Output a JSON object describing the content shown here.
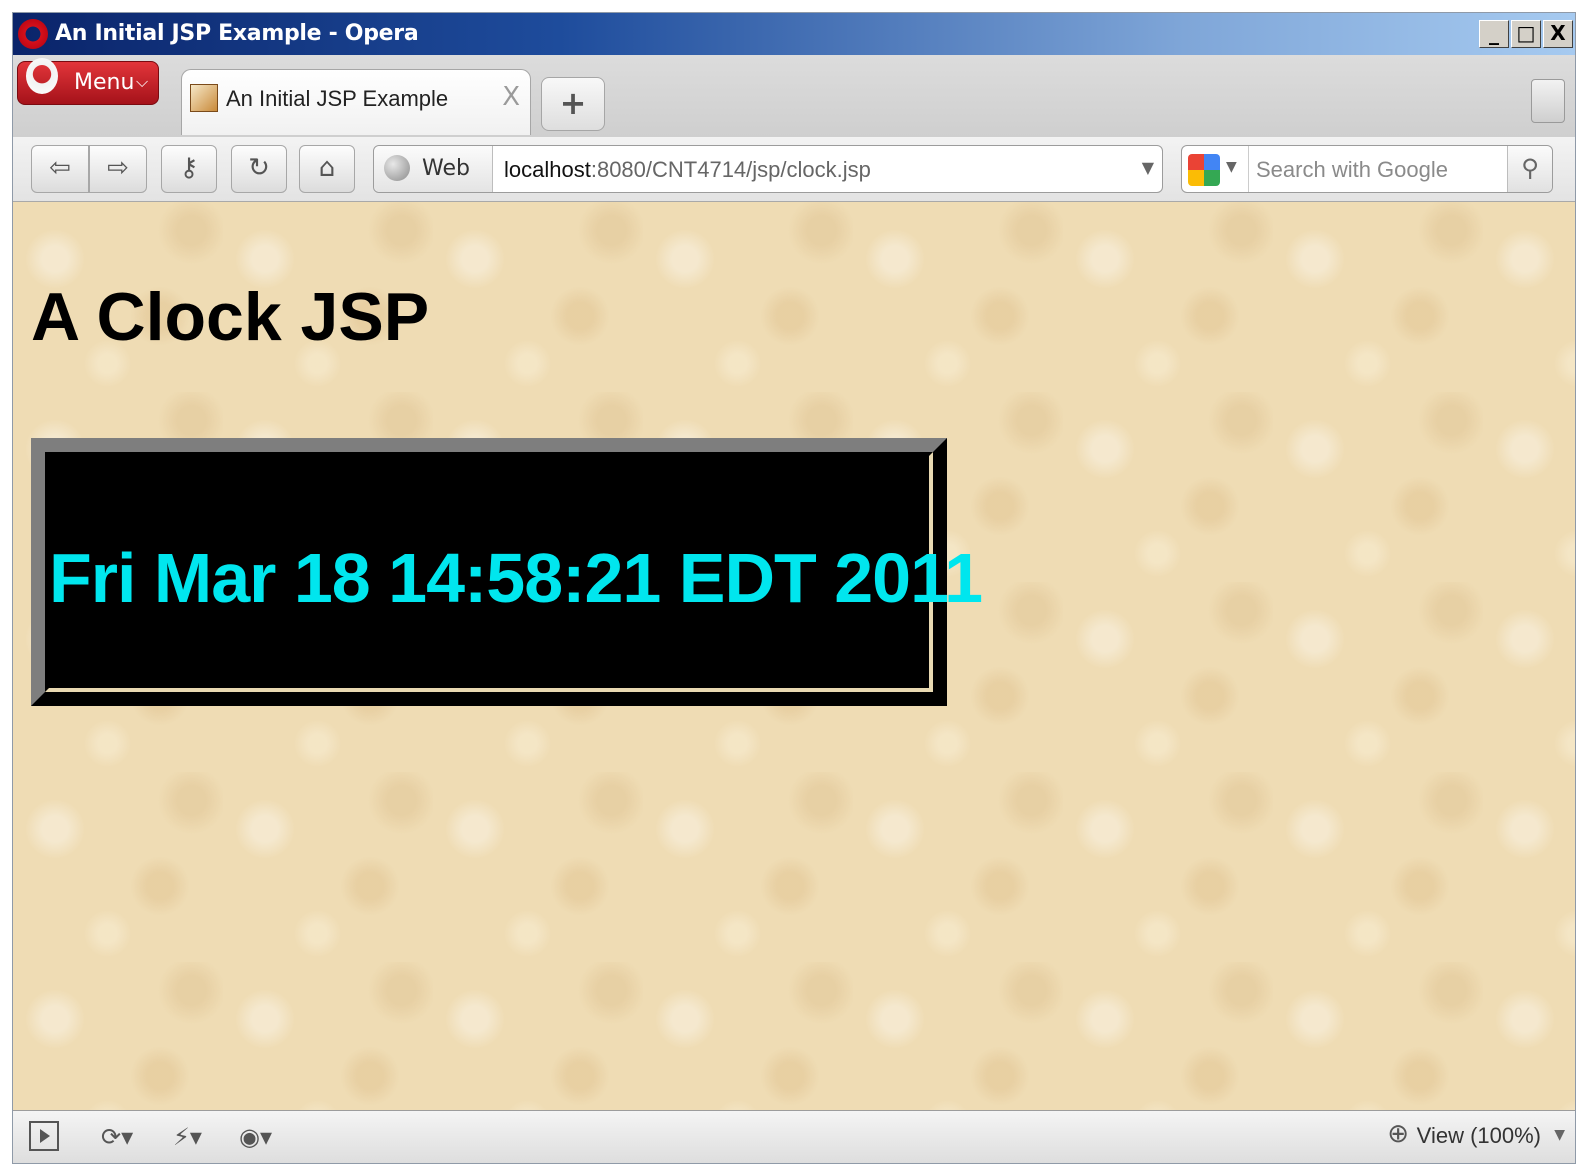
{
  "window": {
    "title": "An Initial JSP Example - Opera",
    "controls": {
      "minimize": "_",
      "maximize": "□",
      "close": "X"
    }
  },
  "tabbar": {
    "menu_label": "Menu",
    "tabs": [
      {
        "title": "An Initial JSP Example",
        "close": "X"
      }
    ],
    "new_tab": "+"
  },
  "navbar": {
    "buttons": {
      "back": "⇦",
      "forward": "⇨",
      "wand": "⚷",
      "reload": "↻",
      "home": "⌂"
    },
    "web_label": "Web",
    "url_host": "localhost",
    "url_path": ":8080/CNT4714/jsp/clock.jsp",
    "search_placeholder": "Search with Google"
  },
  "page": {
    "heading": "A Clock JSP",
    "clock_text": "Fri Mar 18 14:58:21 EDT 2011",
    "clock_color": "#00e6ee"
  },
  "statusbar": {
    "zoom_label": "View (100%)"
  },
  "icons": [
    "opera-logo-icon",
    "favicon-icon",
    "back-icon",
    "forward-icon",
    "wand-icon",
    "reload-icon",
    "home-icon",
    "globe-icon",
    "google-icon",
    "search-icon",
    "trash-icon",
    "panel-toggle-icon",
    "sync-icon",
    "unite-icon",
    "turbo-icon",
    "zoom-icon"
  ]
}
